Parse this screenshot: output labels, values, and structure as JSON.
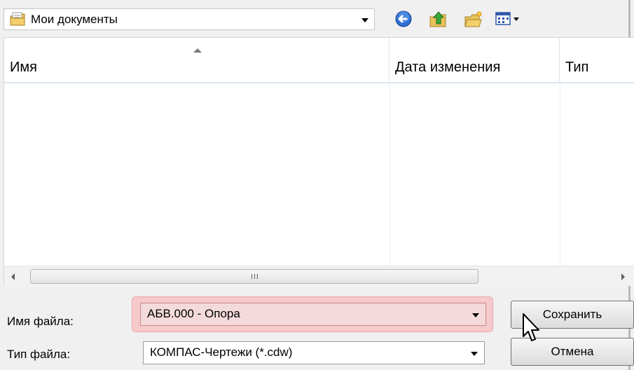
{
  "toolbar": {
    "location": "Мои документы",
    "icons": [
      "back-icon",
      "up-folder-icon",
      "new-folder-icon",
      "view-menu-icon"
    ]
  },
  "list": {
    "columns": [
      "Имя",
      "Дата изменения",
      "Тип"
    ],
    "rows": [],
    "scroll_grip": "III"
  },
  "form": {
    "filename_label": "Имя файла:",
    "filename_value": "АБВ.000 - Опора",
    "filetype_label": "Тип файла:",
    "filetype_value": "КОМПАС-Чертежи (*.cdw)"
  },
  "buttons": {
    "save": "Сохранить",
    "cancel": "Отмена"
  },
  "colors": {
    "highlight": "#f6c9cb",
    "accent": "#1e66c9"
  }
}
